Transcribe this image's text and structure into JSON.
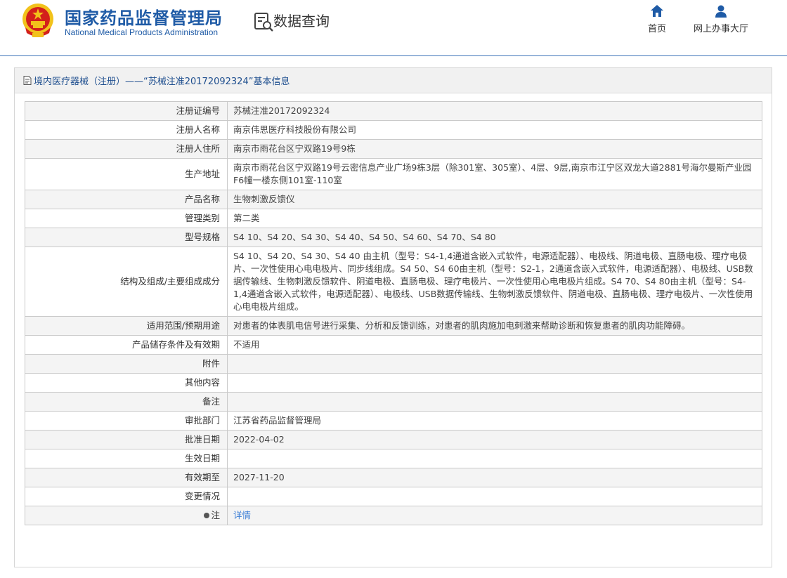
{
  "header": {
    "brand_cn": "国家药品监督管理局",
    "brand_en": "National Medical Products Administration",
    "query_title": "数据查询",
    "nav": [
      {
        "label": "首页",
        "icon": "home-icon"
      },
      {
        "label": "网上办事大厅",
        "icon": "user-icon"
      }
    ]
  },
  "panel": {
    "title": "境内医疗器械（注册）——“苏械注准20172092324”基本信息",
    "icon": "document-icon"
  },
  "rows": [
    {
      "key": "注册证编号",
      "value": "苏械注准20172092324"
    },
    {
      "key": "注册人名称",
      "value": "南京伟思医疗科技股份有限公司"
    },
    {
      "key": "注册人住所",
      "value": "南京市雨花台区宁双路19号9栋"
    },
    {
      "key": "生产地址",
      "value": "南京市雨花台区宁双路19号云密信息产业广场9栋3层（除301室、305室）、4层、9层,南京市江宁区双龙大道2881号海尔曼斯产业园F6幢一楼东侧101室-110室"
    },
    {
      "key": "产品名称",
      "value": "生物刺激反馈仪"
    },
    {
      "key": "管理类别",
      "value": "第二类"
    },
    {
      "key": "型号规格",
      "value": "S4 10、S4 20、S4 30、S4 40、S4 50、S4 60、S4 70、S4 80"
    },
    {
      "key": "结构及组成/主要组成成分",
      "value": "S4 10、S4 20、S4 30、S4 40 由主机（型号：S4-1,4通道含嵌入式软件，电源适配器）、电极线、阴道电极、直肠电极、理疗电极片、一次性使用心电电极片、同步线组成。S4 50、S4 60由主机（型号：S2-1，2通道含嵌入式软件，电源适配器）、电极线、USB数据传输线、生物刺激反馈软件、阴道电极、直肠电极、理疗电极片、一次性使用心电电极片组成。S4 70、S4 80由主机（型号：S4-1,4通道含嵌入式软件，电源适配器）、电极线、USB数据传输线、生物刺激反馈软件、阴道电极、直肠电极、理疗电极片、一次性使用心电电极片组成。"
    },
    {
      "key": "适用范围/预期用途",
      "value": "对患者的体表肌电信号进行采集、分析和反馈训练，对患者的肌肉施加电刺激来帮助诊断和恢复患者的肌肉功能障碍。"
    },
    {
      "key": "产品储存条件及有效期",
      "value": "不适用"
    },
    {
      "key": "附件",
      "value": ""
    },
    {
      "key": "其他内容",
      "value": ""
    },
    {
      "key": "备注",
      "value": ""
    },
    {
      "key": "审批部门",
      "value": "江苏省药品监督管理局"
    },
    {
      "key": "批准日期",
      "value": "2022-04-02"
    },
    {
      "key": "生效日期",
      "value": ""
    },
    {
      "key": "有效期至",
      "value": "2027-11-20"
    },
    {
      "key": "变更情况",
      "value": ""
    }
  ],
  "note_row": {
    "key": "注",
    "value": "详情",
    "icon": "lightbulb-icon"
  }
}
